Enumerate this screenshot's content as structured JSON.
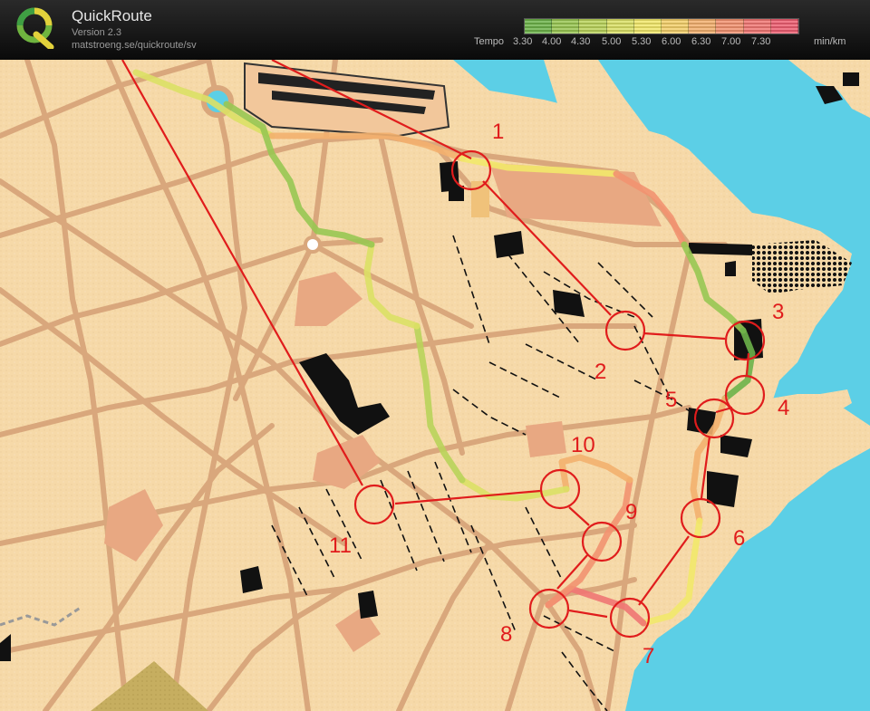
{
  "app": {
    "name": "QuickRoute",
    "version": "Version 2.3",
    "url": "matstroeng.se/quickroute/sv"
  },
  "pace_legend": {
    "label": "Tempo",
    "ticks": [
      "3.30",
      "4.00",
      "4.30",
      "5.00",
      "5.30",
      "6.00",
      "6.30",
      "7.00",
      "7.30"
    ],
    "unit": "min/km",
    "colors": [
      "#6db34a",
      "#98c652",
      "#b9d35a",
      "#dbe065",
      "#f2e86a",
      "#f4cf6a",
      "#f3b06e",
      "#f29270",
      "#f07673",
      "#ee5f72"
    ]
  },
  "map": {
    "control_numbers": [
      "1",
      "2",
      "3",
      "4",
      "5",
      "6",
      "7",
      "8",
      "9",
      "10",
      "11"
    ],
    "colors": {
      "paper": "#f6d9a8",
      "road": "#d9a77c",
      "water": "#5ccfe6",
      "building": "#000000",
      "course": "#e01c1c"
    }
  }
}
